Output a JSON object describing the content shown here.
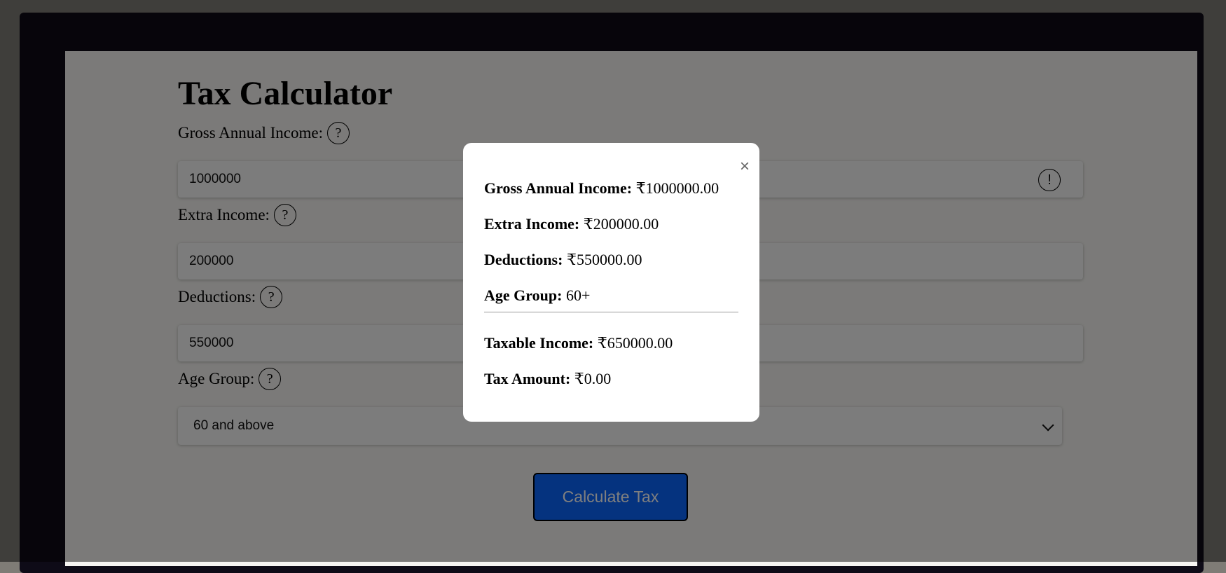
{
  "app": {
    "title": "Tax Calculator"
  },
  "form": {
    "gross_income": {
      "label": "Gross Annual Income:",
      "help": "?",
      "value": "1000000",
      "warning": "!"
    },
    "extra_income": {
      "label": "Extra Income:",
      "help": "?",
      "value": "200000"
    },
    "deductions": {
      "label": "Deductions:",
      "help": "?",
      "value": "550000"
    },
    "age_group": {
      "label": "Age Group:",
      "help": "?",
      "selected": "60 and above"
    },
    "submit_label": "Calculate Tax"
  },
  "modal": {
    "close": "×",
    "gross_label": "Gross Annual Income:",
    "gross_value": "₹1000000.00",
    "extra_label": "Extra Income:",
    "extra_value": "₹200000.00",
    "deductions_label": "Deductions:",
    "deductions_value": "₹550000.00",
    "age_label": "Age Group:",
    "age_value": "60+",
    "taxable_label": "Taxable Income:",
    "taxable_value": "₹650000.00",
    "tax_label": "Tax Amount:",
    "tax_value": "₹0.00"
  },
  "colors": {
    "frame": "#0e0b17",
    "page": "#f6f5f2",
    "button": "#0b66ff",
    "overlay": "rgba(0,0,0,0.5)"
  },
  "icons": {
    "help": "question-circle-icon",
    "warning": "exclamation-circle-icon",
    "close": "close-icon",
    "dropdown": "chevron-down-icon"
  }
}
